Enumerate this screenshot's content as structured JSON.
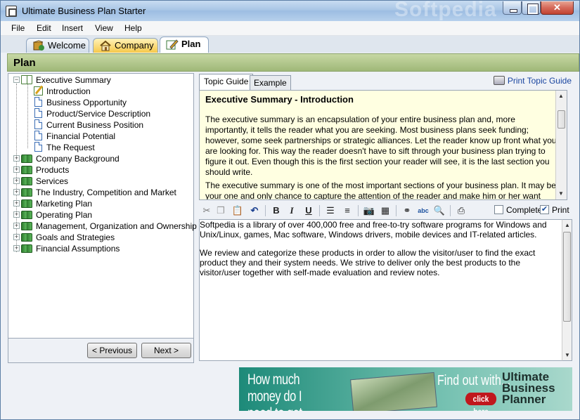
{
  "window": {
    "title": "Ultimate Business Plan Starter",
    "watermark": "Softpedia"
  },
  "menu": [
    "File",
    "Edit",
    "Insert",
    "View",
    "Help"
  ],
  "tabs": [
    {
      "label": "Welcome",
      "icon": "welcome-icon"
    },
    {
      "label": "Company",
      "icon": "house-icon"
    },
    {
      "label": "Plan",
      "icon": "pencil-icon"
    }
  ],
  "section": {
    "title": "Plan"
  },
  "tree": {
    "root": {
      "label": "Executive Summary",
      "expanded": true,
      "children": [
        "Introduction",
        "Business Opportunity",
        "Product/Service Description",
        "Current Business Position",
        "Financial Potential",
        "The Request"
      ]
    },
    "groups": [
      "Company Background",
      "Products",
      "Services",
      "The Industry, Competition and Market",
      "Marketing Plan",
      "Operating Plan",
      "Management, Organization and Ownership",
      "Goals and Strategies",
      "Financial Assumptions"
    ]
  },
  "nav": {
    "prev": "< Previous",
    "next": "Next >"
  },
  "topic_tabs": [
    "Topic Guide",
    "Example"
  ],
  "print_topic_guide": "Print Topic Guide",
  "guide": {
    "title": "Executive Summary - Introduction",
    "p1": "The executive summary is an encapsulation of your entire business plan and, more importantly, it tells the reader what you are seeking. Most business plans seek funding; however, some seek partnerships or strategic alliances. Let the reader know up front what you are looking for. This way the reader doesn't have to sift through your business plan trying to figure it out. Even though this is the first section your reader will see, it is the last section you should write.",
    "p2": "The executive summary is one of the most important sections of your business plan. It may be your one and only chance to capture the attention of the reader and make him or her want"
  },
  "toolbar": {
    "complete_label": "Complete",
    "print_label": "Print",
    "complete_checked": false,
    "print_checked": true
  },
  "editor": {
    "p1": "Softpedia is a library of over 400,000 free and free-to-try software programs for Windows and Unix/Linux, games, Mac software, Windows drivers, mobile devices and IT-related articles.",
    "p2": "We review and categorize these products in order to allow the visitor/user to find the exact product they and their system needs. We strive to deliver only the best products to the visitor/user together with self-made evaluation and review notes."
  },
  "banner": {
    "left_line1": "How much money do I",
    "left_line2": "need to get started?",
    "mid": "Find out with...",
    "cta": "click here",
    "brand_line1": "Ultimate",
    "brand_line2": "Business",
    "brand_line3": "Planner"
  }
}
